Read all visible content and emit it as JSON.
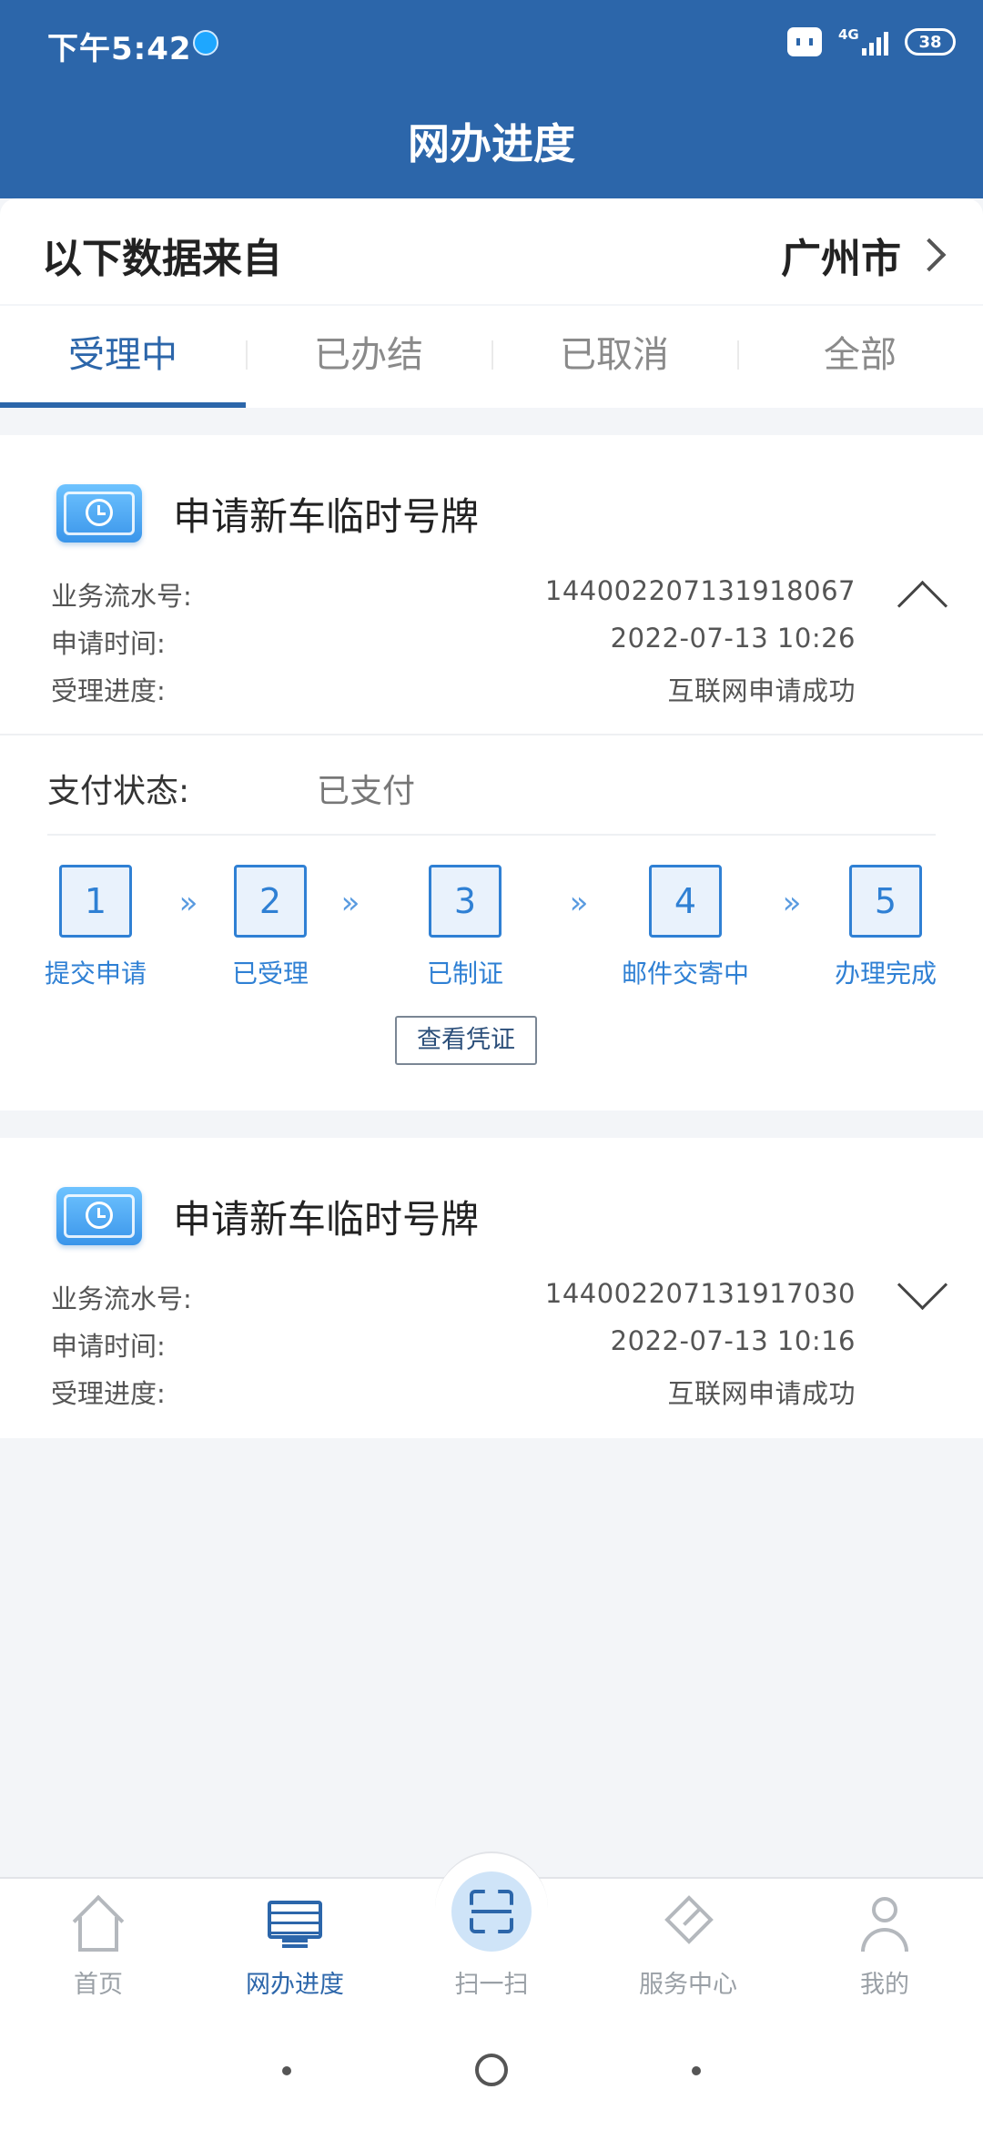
{
  "status": {
    "time": "下午5:42",
    "network": "4G",
    "battery": "38"
  },
  "header": {
    "title": "网办进度"
  },
  "source": {
    "label": "以下数据来自",
    "city": "广州市"
  },
  "tabs": [
    {
      "label": "受理中",
      "active": true
    },
    {
      "label": "已办结",
      "active": false
    },
    {
      "label": "已取消",
      "active": false
    },
    {
      "label": "全部",
      "active": false
    }
  ],
  "fields": {
    "serial_label": "业务流水号:",
    "time_label": "申请时间:",
    "progress_label": "受理进度:"
  },
  "cards": [
    {
      "title": "申请新车临时号牌",
      "serial": "144002207131918067",
      "time": "2022-07-13 10:26",
      "progress": "互联网申请成功",
      "expanded": true
    },
    {
      "title": "申请新车临时号牌",
      "serial": "144002207131917030",
      "time": "2022-07-13 10:16",
      "progress": "互联网申请成功",
      "expanded": false
    }
  ],
  "payment": {
    "label": "支付状态:",
    "value": "已支付"
  },
  "steps": [
    {
      "num": "1",
      "label": "提交申请"
    },
    {
      "num": "2",
      "label": "已受理"
    },
    {
      "num": "3",
      "label": "已制证"
    },
    {
      "num": "4",
      "label": "邮件交寄中"
    },
    {
      "num": "5",
      "label": "办理完成"
    }
  ],
  "step_arrow": "»",
  "voucher_button": "查看凭证",
  "nav": [
    {
      "label": "首页",
      "icon": "home-icon"
    },
    {
      "label": "网办进度",
      "icon": "monitor-icon",
      "active": true
    },
    {
      "label": "扫一扫",
      "icon": "scan-icon"
    },
    {
      "label": "服务中心",
      "icon": "service-icon"
    },
    {
      "label": "我的",
      "icon": "user-icon"
    }
  ],
  "colors": {
    "primary": "#2c66aa",
    "step": "#2f80d4",
    "background": "#f3f5f8"
  }
}
